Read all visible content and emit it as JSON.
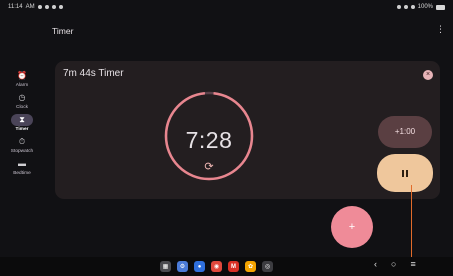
{
  "status_bar": {
    "time": "11:14",
    "am_pm": "AM",
    "battery": "100%"
  },
  "app_bar": {
    "title": "Timer",
    "menu_icon": "more-vert-icon"
  },
  "nav": {
    "items": [
      {
        "label": "Alarm",
        "icon": "alarm-icon",
        "glyph": "⏰",
        "active": false
      },
      {
        "label": "Clock",
        "icon": "clock-icon",
        "glyph": "◷",
        "active": false
      },
      {
        "label": "Timer",
        "icon": "hourglass-icon",
        "glyph": "⧗",
        "active": true
      },
      {
        "label": "Stopwatch",
        "icon": "stopwatch-icon",
        "glyph": "⏱",
        "active": false
      },
      {
        "label": "Bedtime",
        "icon": "bed-icon",
        "glyph": "▬",
        "active": false
      }
    ]
  },
  "timer": {
    "name": "7m 44s Timer",
    "remaining": "7:28",
    "progress_fraction": 0.966,
    "add_minute_label": "+1:00",
    "close_glyph": "×",
    "reset_glyph": "⟳",
    "fab_glyph": "+"
  },
  "colors": {
    "background": "#111114",
    "card": "#231e20",
    "dial_ring": "#e8868f",
    "dial_track": "#59414a",
    "fab": "#ef8b98",
    "pause_button": "#efc79c",
    "add_minute_button": "#5a3f42"
  },
  "taskbar": {
    "apps": [
      {
        "name": "app-grid-icon",
        "glyph": "▦",
        "color": "#4a4a4f"
      },
      {
        "name": "settings-icon",
        "glyph": "⚙",
        "color": "#4b7bd8"
      },
      {
        "name": "messages-icon",
        "glyph": "●",
        "color": "#2f6fdc"
      },
      {
        "name": "chrome-icon",
        "glyph": "◉",
        "color": "#e0483c"
      },
      {
        "name": "gmail-icon",
        "glyph": "M",
        "color": "#d93025"
      },
      {
        "name": "photos-icon",
        "glyph": "✿",
        "color": "#f4a400"
      },
      {
        "name": "camera-icon",
        "glyph": "◎",
        "color": "#3c3c40"
      }
    ],
    "nav_back": "‹",
    "nav_home": "○",
    "nav_menu": "≡"
  }
}
